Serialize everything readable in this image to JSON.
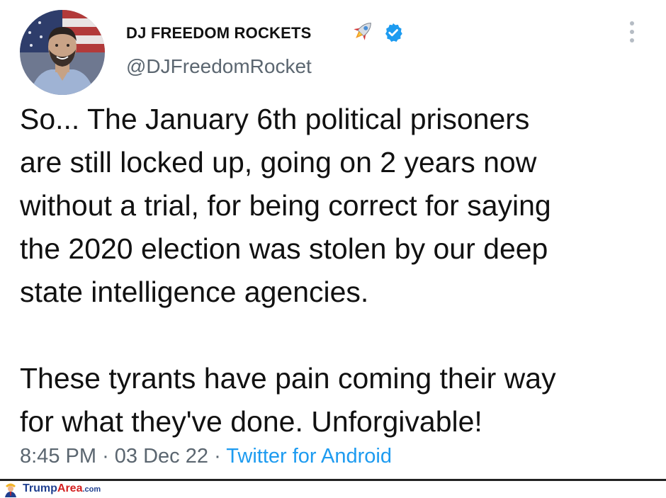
{
  "tweet": {
    "display_name": "DJ FREEDOM ROCKETS",
    "name_emoji_icon": "rocket-icon",
    "verified_icon": "verified-badge-icon",
    "handle": "@DJFreedomRocket",
    "more_icon": "more-vertical-icon",
    "text_lines": [
      "So... The January 6th political prisoners",
      "are still locked up, going on 2 years now",
      "without a trial, for being correct for saying",
      "the 2020 election was stolen by our deep",
      "state intelligence agencies.",
      "These tyrants have pain coming their way",
      "for what they've done. Unforgivable!"
    ],
    "time": "8:45 PM",
    "separator": "·",
    "date": "03 Dec 22",
    "source": "Twitter for Android"
  },
  "watermark": {
    "brand_part1": "Trump",
    "brand_part2": "Area",
    "brand_suffix": ".com",
    "colors": {
      "blue": "#1f3f8f",
      "red": "#d42020"
    }
  },
  "colors": {
    "text": "#111111",
    "secondary": "#5b6670",
    "link": "#1d9bf0",
    "verified": "#1d9bf0"
  }
}
